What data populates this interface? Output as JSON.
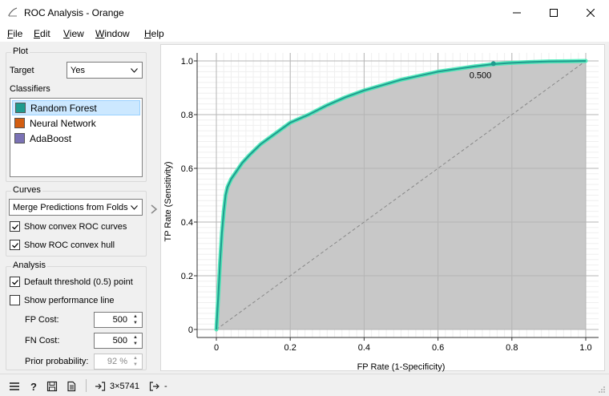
{
  "window": {
    "title": "ROC Analysis - Orange",
    "icon": "orange-app-icon",
    "controls": [
      "minimize-icon",
      "maximize-icon",
      "close-icon"
    ]
  },
  "menu": [
    {
      "label": "File",
      "underline": "F",
      "rest": "ile"
    },
    {
      "label": "Edit",
      "underline": "E",
      "rest": "dit"
    },
    {
      "label": "View",
      "underline": "V",
      "rest": "iew"
    },
    {
      "label": "Window",
      "underline": "W",
      "rest": "indow"
    },
    {
      "label": "Help",
      "underline": "H",
      "rest": "elp"
    }
  ],
  "plot_group": {
    "title": "Plot",
    "target_label": "Target",
    "target_value": "Yes",
    "classifiers_label": "Classifiers",
    "classifiers": [
      {
        "name": "Random Forest",
        "color": "#1f9c8f",
        "selected": true
      },
      {
        "name": "Neural Network",
        "color": "#d35e12",
        "selected": false
      },
      {
        "name": "AdaBoost",
        "color": "#7b72b5",
        "selected": false
      }
    ]
  },
  "curves_group": {
    "title": "Curves",
    "merge_value": "Merge Predictions from Folds",
    "show_convex_roc": {
      "label": "Show convex ROC curves",
      "checked": true
    },
    "show_convex_hull": {
      "label": "Show ROC convex hull",
      "checked": true
    }
  },
  "analysis_group": {
    "title": "Analysis",
    "default_threshold": {
      "label": "Default threshold (0.5) point",
      "checked": true
    },
    "show_performance": {
      "label": "Show performance line",
      "checked": false
    },
    "fp_cost_label": "FP Cost:",
    "fp_cost_value": "500",
    "fn_cost_label": "FN Cost:",
    "fn_cost_value": "500",
    "prior_label": "Prior probability:",
    "prior_value": "92 %"
  },
  "chart_data": {
    "type": "line",
    "xlabel": "FP Rate (1-Specificity)",
    "ylabel": "TP Rate (Sensitivity)",
    "xlim": [
      0,
      1
    ],
    "ylim": [
      0,
      1
    ],
    "x_ticks": [
      "0",
      "0.2",
      "0.4",
      "0.6",
      "0.8",
      "1.0"
    ],
    "y_ticks": [
      "0",
      "0.2",
      "0.4",
      "0.6",
      "0.8",
      "1.0"
    ],
    "grid": true,
    "threshold_label": "0.500",
    "threshold_point": [
      0.75,
      0.99
    ],
    "series": [
      {
        "name": "Random Forest",
        "color": "#1f9c8f",
        "hull_color": "#3ee8b4",
        "x": [
          0,
          0.005,
          0.01,
          0.015,
          0.02,
          0.025,
          0.03,
          0.04,
          0.05,
          0.07,
          0.09,
          0.12,
          0.15,
          0.2,
          0.25,
          0.3,
          0.35,
          0.4,
          0.45,
          0.5,
          0.55,
          0.6,
          0.65,
          0.7,
          0.75,
          0.8,
          0.85,
          0.9,
          0.95,
          1.0
        ],
        "y": [
          0,
          0.12,
          0.25,
          0.36,
          0.44,
          0.5,
          0.53,
          0.56,
          0.58,
          0.62,
          0.65,
          0.69,
          0.72,
          0.77,
          0.8,
          0.835,
          0.865,
          0.89,
          0.91,
          0.93,
          0.945,
          0.96,
          0.97,
          0.98,
          0.988,
          0.993,
          0.996,
          0.998,
          0.999,
          1.0
        ]
      }
    ],
    "diagonal": true
  },
  "statusbar": {
    "icons": [
      "menu-icon",
      "help-icon",
      "save-icon",
      "report-icon"
    ],
    "input_summary": "3×5741",
    "output_summary": "-"
  }
}
